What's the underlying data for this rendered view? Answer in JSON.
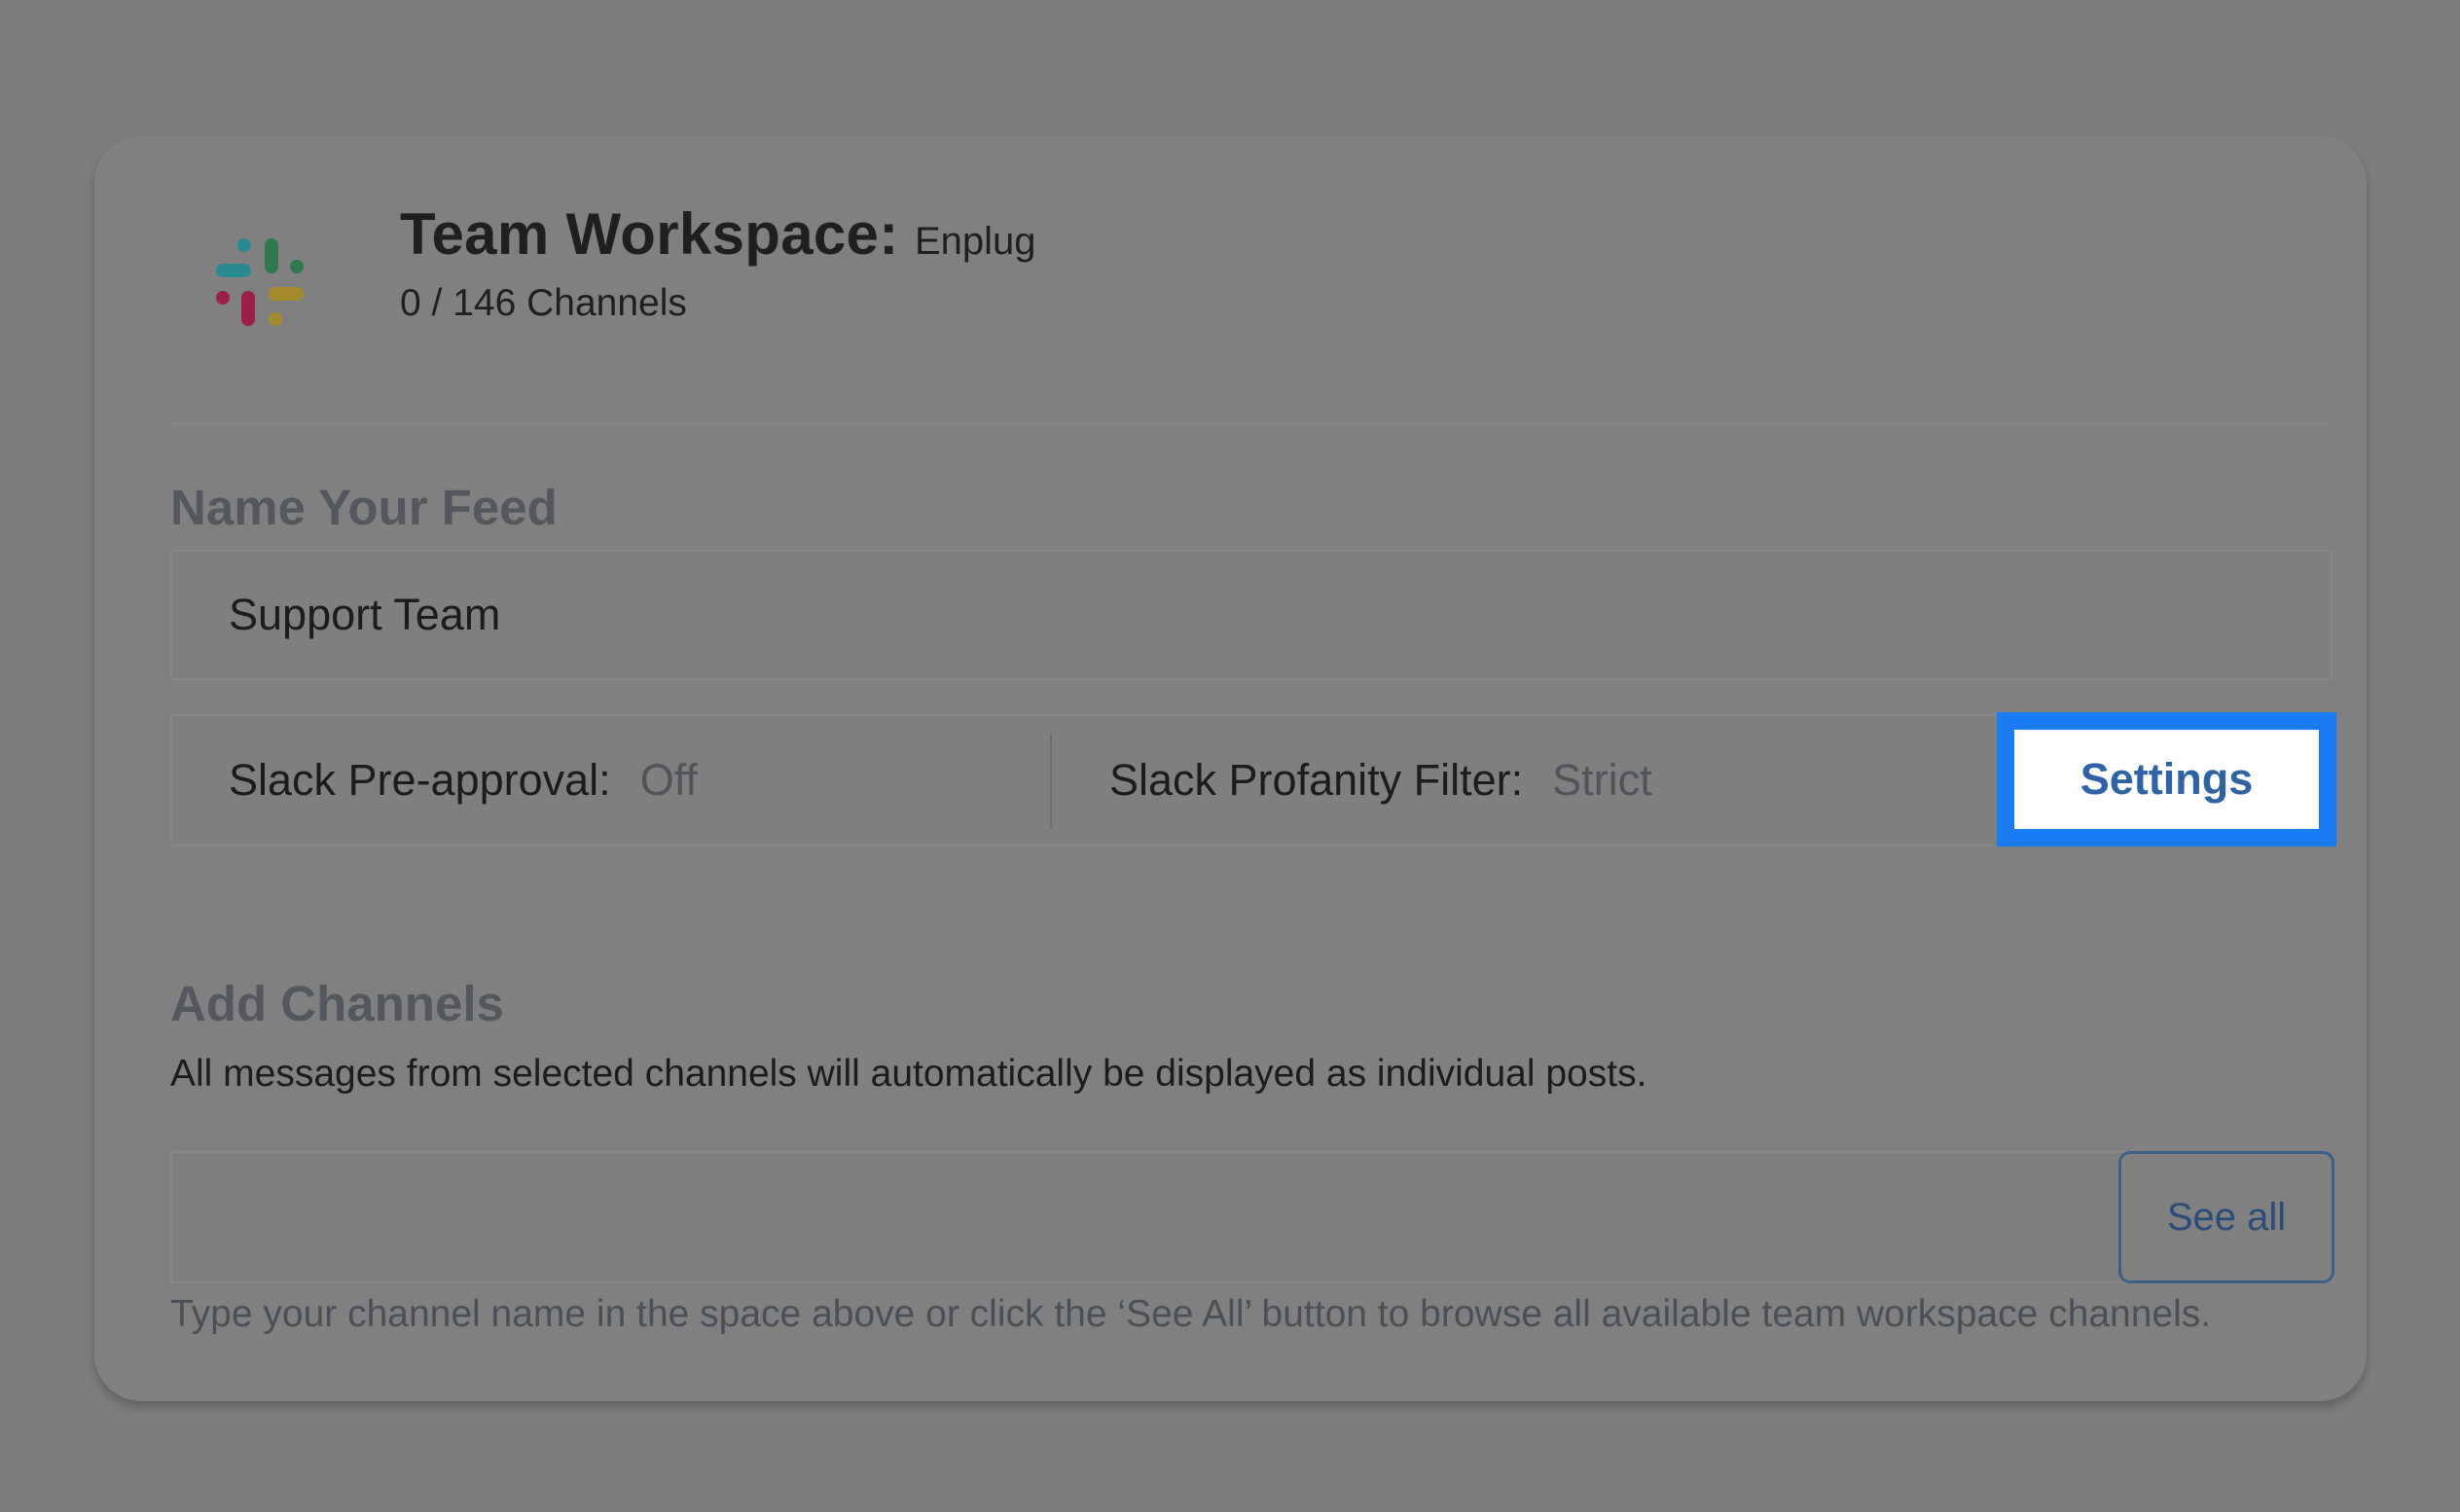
{
  "workspace": {
    "label": "Team Workspace:",
    "name": "Enplug",
    "channel_count": "0 / 146 Channels",
    "logo_icon": "slack-icon"
  },
  "feed": {
    "heading": "Name Your Feed",
    "name_value": "Support Team"
  },
  "slack_settings": {
    "preapproval_label": "Slack Pre-approval:",
    "preapproval_value": "Off",
    "profanity_label": "Slack Profanity Filter:",
    "profanity_value": "Strict",
    "settings_button": "Settings",
    "highlight_color": "#1a7cf4"
  },
  "channels": {
    "heading": "Add Channels",
    "description": "All messages from selected channels will automatically be displayed as individual posts.",
    "input_value": "",
    "see_all_button": "See all",
    "hint": "Type your channel name in the space above or click the ‘See All’ button to browse all available team workspace channels."
  }
}
